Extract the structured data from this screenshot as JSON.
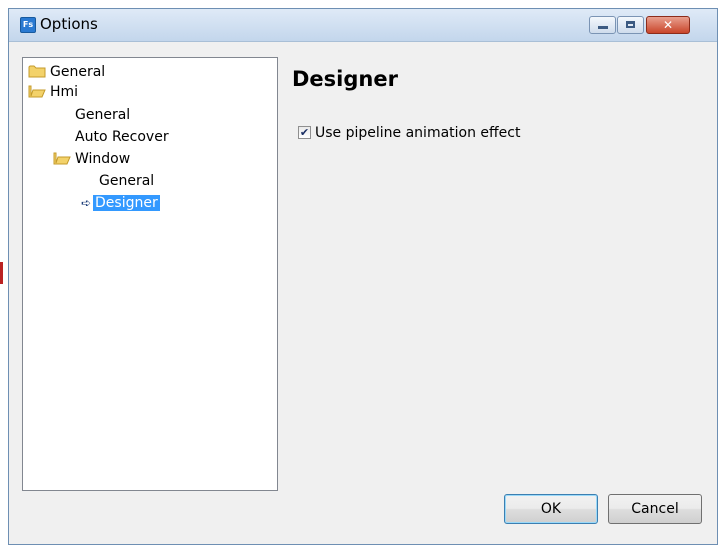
{
  "window": {
    "title": "Options",
    "app_icon_text": "Fs",
    "icons": {
      "app": "fs-app-icon",
      "minimize": "minimize-icon",
      "maximize": "maximize-icon",
      "close": "close-icon"
    },
    "close_glyph": "✕"
  },
  "tree": {
    "items": [
      {
        "label": "General",
        "icon": "folder-icon"
      },
      {
        "label": "Hmi",
        "icon": "folder-open-icon"
      },
      {
        "label": "General",
        "icon": ""
      },
      {
        "label": "Auto Recover",
        "icon": ""
      },
      {
        "label": "Window",
        "icon": "folder-open-icon"
      },
      {
        "label": "General",
        "icon": ""
      },
      {
        "label": "Designer",
        "icon": "arrow-right-icon",
        "selected": true
      }
    ]
  },
  "pane": {
    "title": "Designer",
    "options": [
      {
        "label": "Use pipeline animation effect",
        "checked": true
      }
    ]
  },
  "buttons": {
    "ok": "OK",
    "cancel": "Cancel"
  },
  "colors": {
    "selection": "#3399ff",
    "title_bar": "#c3d6ec",
    "close_button": "#c9452a"
  }
}
